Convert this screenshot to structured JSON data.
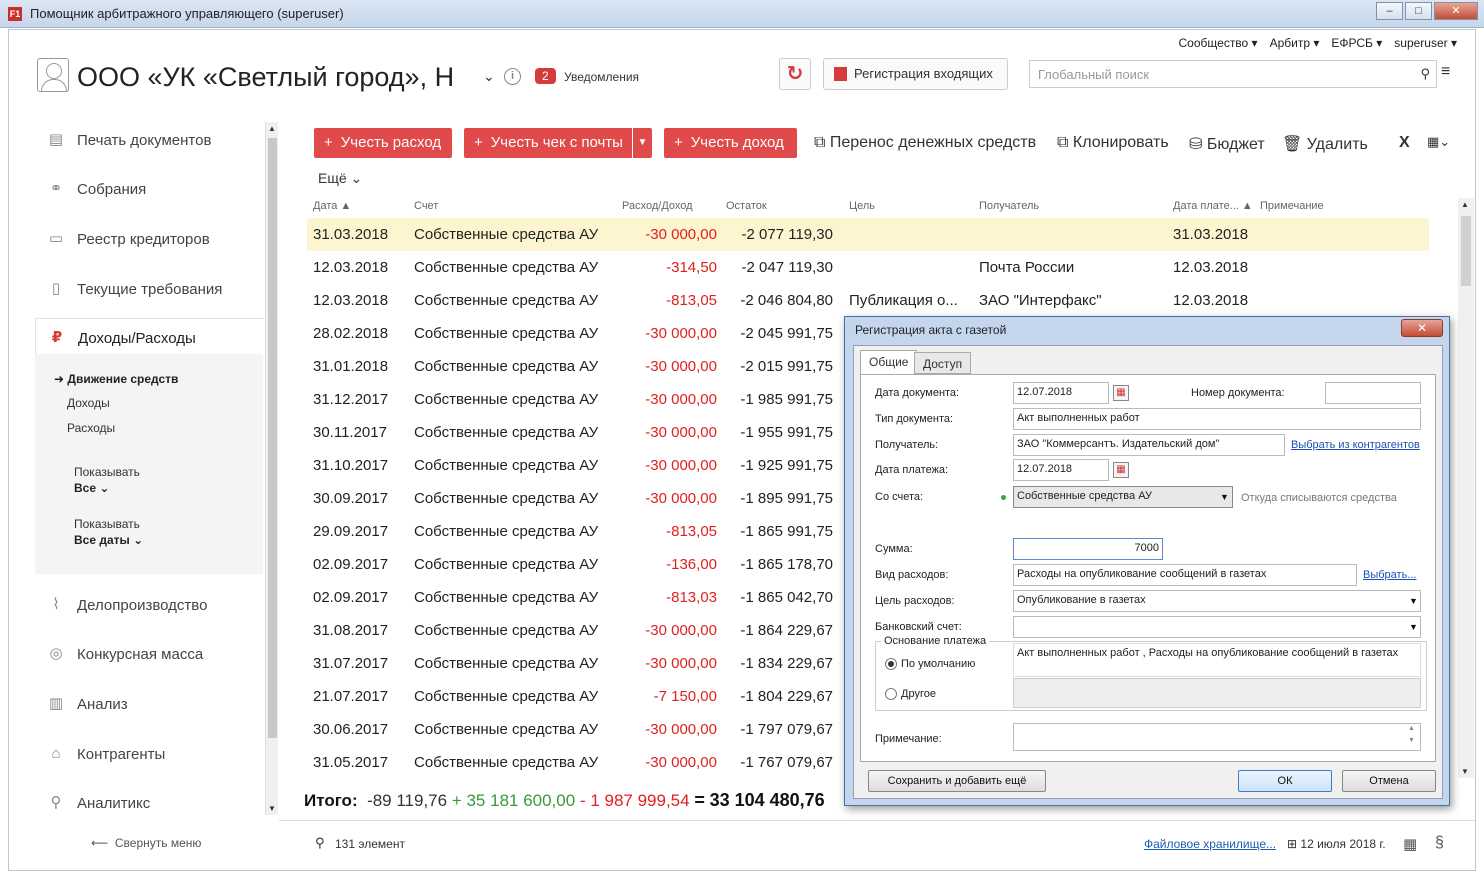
{
  "window": {
    "title": "Помощник арбитражного управляющего (superuser)",
    "app_icon": "F1"
  },
  "topmenu": [
    "Сообщество ▾",
    "Арбитр ▾",
    "ЕФРСБ ▾",
    "superuser ▾"
  ],
  "header": {
    "org_name": "ООО «УК «Светлый город», Н",
    "notif_count": "2",
    "notif_label": "Уведомления",
    "register_label": "Регистрация входящих",
    "search_placeholder": "Глобальный поиск"
  },
  "sidebar": {
    "items": [
      {
        "label": "Печать документов",
        "icon": "document-icon"
      },
      {
        "label": "Собрания",
        "icon": "handshake-icon"
      },
      {
        "label": "Реестр кредиторов",
        "icon": "registry-icon"
      },
      {
        "label": "Текущие требования",
        "icon": "bottle-icon"
      },
      {
        "label": "Доходы/Расходы",
        "icon": "ruble-icon"
      },
      {
        "label": "Делопроизводство",
        "icon": "paperclip-icon"
      },
      {
        "label": "Конкурсная масса",
        "icon": "mass-icon"
      },
      {
        "label": "Анализ",
        "icon": "bar-chart-icon"
      },
      {
        "label": "Контрагенты",
        "icon": "bank-icon"
      },
      {
        "label": "Аналитикс",
        "icon": "search-icon"
      }
    ],
    "sub": {
      "active": "Движение средств",
      "income": "Доходы",
      "expense": "Расходы",
      "show1_label": "Показывать",
      "show1_value": "Все",
      "show2_label": "Показывать",
      "show2_value": "Все даты"
    },
    "collapse_label": "Свернуть меню"
  },
  "toolbar": {
    "btn_expense": "Учесть расход",
    "btn_receipt": "Учесть чек с почты",
    "btn_income": "Учесть доход",
    "transfer": "Перенос денежных средств",
    "clone": "Клонировать",
    "budget": "Бюджет",
    "delete": "Удалить",
    "more": "Ещё"
  },
  "columns": {
    "date": "Дата ▲",
    "account": "Счет",
    "amount": "Расход/Доход",
    "balance": "Остаток",
    "goal": "Цель",
    "receiver": "Получатель",
    "paydate": "Дата плате... ▲",
    "note": "Примечание"
  },
  "rows": [
    {
      "date": "31.03.2018",
      "account": "Собственные средства АУ",
      "amount": "-30 000,00",
      "balance": "-2 077 119,30",
      "goal": "",
      "receiver": "",
      "paydate": "31.03.2018"
    },
    {
      "date": "12.03.2018",
      "account": "Собственные средства АУ",
      "amount": "-314,50",
      "balance": "-2 047 119,30",
      "goal": "",
      "receiver": "Почта России",
      "paydate": "12.03.2018"
    },
    {
      "date": "12.03.2018",
      "account": "Собственные средства АУ",
      "amount": "-813,05",
      "balance": "-2 046 804,80",
      "goal": "Публикация о...",
      "receiver": "ЗАО \"Интерфакс\"",
      "paydate": "12.03.2018"
    },
    {
      "date": "28.02.2018",
      "account": "Собственные средства АУ",
      "amount": "-30 000,00",
      "balance": "-2 045 991,75",
      "goal": "",
      "receiver": "",
      "paydate": ""
    },
    {
      "date": "31.01.2018",
      "account": "Собственные средства АУ",
      "amount": "-30 000,00",
      "balance": "-2 015 991,75",
      "goal": "",
      "receiver": "",
      "paydate": ""
    },
    {
      "date": "31.12.2017",
      "account": "Собственные средства АУ",
      "amount": "-30 000,00",
      "balance": "-1 985 991,75",
      "goal": "",
      "receiver": "",
      "paydate": ""
    },
    {
      "date": "30.11.2017",
      "account": "Собственные средства АУ",
      "amount": "-30 000,00",
      "balance": "-1 955 991,75",
      "goal": "",
      "receiver": "",
      "paydate": ""
    },
    {
      "date": "31.10.2017",
      "account": "Собственные средства АУ",
      "amount": "-30 000,00",
      "balance": "-1 925 991,75",
      "goal": "",
      "receiver": "",
      "paydate": ""
    },
    {
      "date": "30.09.2017",
      "account": "Собственные средства АУ",
      "amount": "-30 000,00",
      "balance": "-1 895 991,75",
      "goal": "",
      "receiver": "",
      "paydate": ""
    },
    {
      "date": "29.09.2017",
      "account": "Собственные средства АУ",
      "amount": "-813,05",
      "balance": "-1 865 991,75",
      "goal": "",
      "receiver": "",
      "paydate": ""
    },
    {
      "date": "02.09.2017",
      "account": "Собственные средства АУ",
      "amount": "-136,00",
      "balance": "-1 865 178,70",
      "goal": "",
      "receiver": "",
      "paydate": ""
    },
    {
      "date": "02.09.2017",
      "account": "Собственные средства АУ",
      "amount": "-813,03",
      "balance": "-1 865 042,70",
      "goal": "",
      "receiver": "",
      "paydate": ""
    },
    {
      "date": "31.08.2017",
      "account": "Собственные средства АУ",
      "amount": "-30 000,00",
      "balance": "-1 864 229,67",
      "goal": "",
      "receiver": "",
      "paydate": ""
    },
    {
      "date": "31.07.2017",
      "account": "Собственные средства АУ",
      "amount": "-30 000,00",
      "balance": "-1 834 229,67",
      "goal": "",
      "receiver": "",
      "paydate": ""
    },
    {
      "date": "21.07.2017",
      "account": "Собственные средства АУ",
      "amount": "-7 150,00",
      "balance": "-1 804 229,67",
      "goal": "",
      "receiver": "",
      "paydate": ""
    },
    {
      "date": "30.06.2017",
      "account": "Собственные средства АУ",
      "amount": "-30 000,00",
      "balance": "-1 797 079,67",
      "goal": "",
      "receiver": "",
      "paydate": ""
    },
    {
      "date": "31.05.2017",
      "account": "Собственные средства АУ",
      "amount": "-30 000,00",
      "balance": "-1 767 079,67",
      "goal": "",
      "receiver": "",
      "paydate": ""
    }
  ],
  "totals": {
    "label": "Итого:",
    "base": "-89 119,76",
    "plus": "+ 35 181 600,00",
    "minus": "- 1 987 999,54",
    "eq": "=",
    "result": "33 104 480,76"
  },
  "status": {
    "count": "131 элемент",
    "file_storage": "Файловое хранилище...",
    "date": "12 июля 2018 г."
  },
  "dialog": {
    "title": "Регистрация акта с газетой",
    "tabs": [
      "Общие",
      "Доступ"
    ],
    "doc_date_label": "Дата документа:",
    "doc_date": "12.07.2018",
    "doc_num_label": "Номер документа:",
    "doc_num": "",
    "doc_type_label": "Тип документа:",
    "doc_type": "Акт выполненных работ",
    "receiver_label": "Получатель:",
    "receiver": "ЗАО \"Коммерсантъ. Издательский дом\"",
    "choose_contractor": "Выбрать из контрагентов",
    "pay_date_label": "Дата платежа:",
    "pay_date": "12.07.2018",
    "from_account_label": "Со счета:",
    "from_account": "Собственные средства АУ",
    "from_hint": "Откуда списываются средства",
    "sum_label": "Сумма:",
    "sum": "7000",
    "exp_type_label": "Вид расходов:",
    "exp_type": "Расходы на опубликование сообщений в газетах",
    "choose": "Выбрать...",
    "exp_goal_label": "Цель расходов:",
    "exp_goal": "Опубликование в газетах",
    "bank_label": "Банковский счет:",
    "bank": "",
    "basis_label": "Основание платежа",
    "basis_default": "По умолчанию",
    "basis_default_text": "Акт выполненных работ , Расходы на опубликование сообщений в газетах",
    "basis_other": "Другое",
    "note_label": "Примечание:",
    "note": "",
    "btn_save_add": "Сохранить и добавить ещё",
    "btn_ok": "ОК",
    "btn_cancel": "Отмена"
  }
}
